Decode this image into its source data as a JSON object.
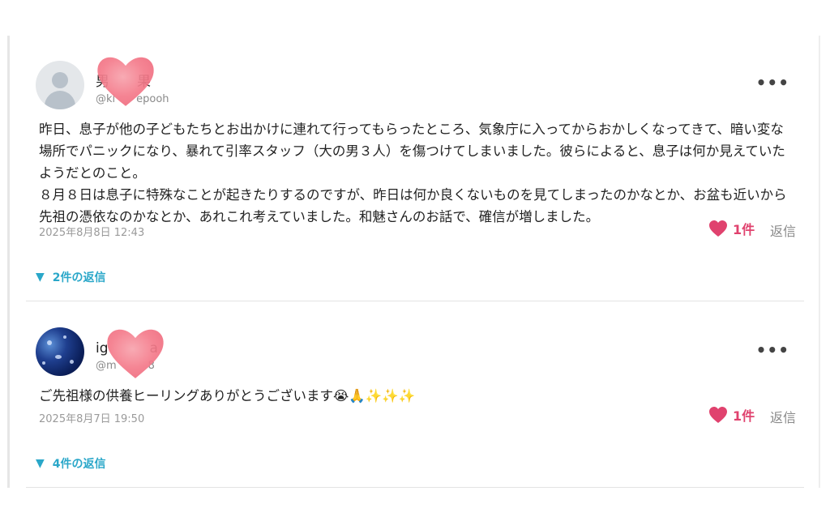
{
  "comments": [
    {
      "name": "男　　果",
      "handle": "@ki　　epooh",
      "text": "昨日、息子が他の子どもたちとお出かけに連れて行ってもらったところ、気象庁に入ってからおかしくなってきて、暗い変な場所でパニックになり、暴れて引率スタッフ（大の男３人）を傷つけてしまいました。彼らによると、息子は何か見えていたようだとのこと。\n８月８日は息子に特殊なことが起きたりするのですが、昨日は何か良くないものを見てしまったのかなとか、お盆も近いから先祖の憑依なのかなとか、あれこれ考えていました。和魅さんのお話で、確信が増しました。",
      "date": "2025年8月8日 12:43",
      "like_count": "1件",
      "reply_label": "返信",
      "replies_toggle": "2件の返信"
    },
    {
      "name": "ig　　　a",
      "handle": "@m　　　8",
      "text": "ご先祖様の供養ヒーリングありがとうございます😭🙏✨✨✨",
      "date": "2025年8月7日 19:50",
      "like_count": "1件",
      "reply_label": "返信",
      "replies_toggle": "4件の返信"
    }
  ],
  "icons": {
    "more": "more-horizontal-icon",
    "like": "heart-icon",
    "toggle": "triangle-down-icon",
    "sticker": "heart-sticker"
  },
  "colors": {
    "accent": "#2aa7c9",
    "like": "#e0426e",
    "sticker": "#f47a8a"
  }
}
